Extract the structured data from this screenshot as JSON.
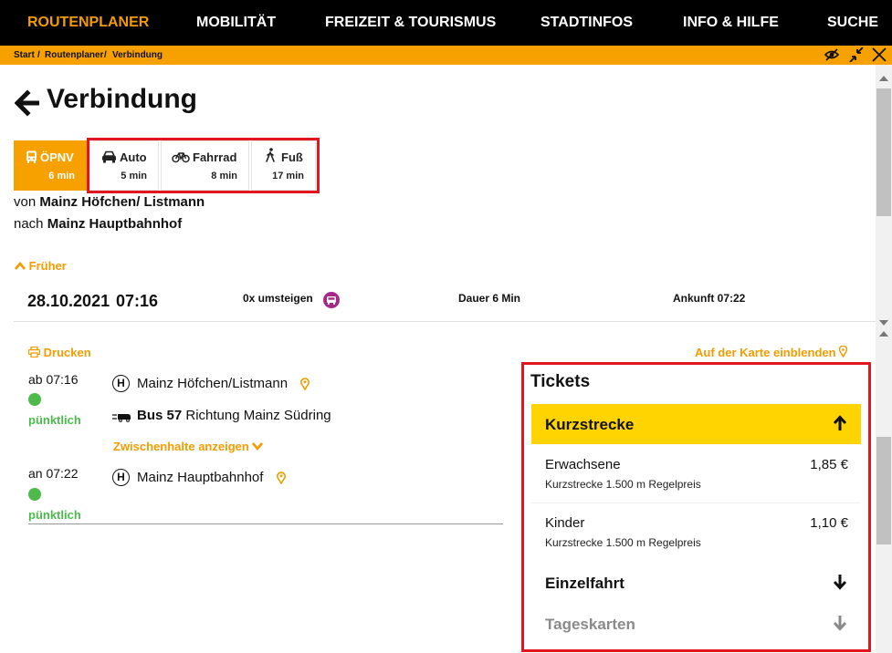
{
  "nav": {
    "items": [
      "ROUTENPLANER",
      "MOBILITÄT",
      "FREIZEIT & TOURISMUS",
      "STADTINFOS",
      "INFO & HILFE",
      "SUCHE"
    ]
  },
  "breadcrumb": {
    "items": [
      "Start",
      "Routenplaner",
      "Verbindung"
    ],
    "separator": "/"
  },
  "page": {
    "title": "Verbindung"
  },
  "modes": [
    {
      "label": "ÖPNV",
      "time": "6 min",
      "icon": "bus-icon",
      "selected": true
    },
    {
      "label": "Auto",
      "time": "5 min",
      "icon": "car-icon",
      "selected": false
    },
    {
      "label": "Fahrrad",
      "time": "8 min",
      "icon": "bicycle-icon",
      "selected": false
    },
    {
      "label": "Fuß",
      "time": "17 min",
      "icon": "walk-icon",
      "selected": false
    }
  ],
  "route": {
    "from_prefix": "von",
    "from": "Mainz Höfchen/ Listmann",
    "to_prefix": "nach",
    "to": "Mainz Hauptbahnhof"
  },
  "earlier_label": "Früher",
  "connection": {
    "date": "28.10.2021",
    "time": "07:16",
    "transfers": "0x umsteigen",
    "duration": "Dauer 6 Min",
    "arrival": "Ankunft 07:22"
  },
  "print_label": "Drucken",
  "map_label": "Auf der Karte einblenden",
  "itinerary": {
    "departure": {
      "time": "ab 07:16",
      "status": "pünktlich",
      "stop": "Mainz Höfchen/Listmann",
      "stop_symbol": "H"
    },
    "line": {
      "name": "Bus 57",
      "direction": "Richtung Mainz Südring"
    },
    "stops_toggle": "Zwischenhalte anzeigen",
    "arrival": {
      "time": "an 07:22",
      "status": "pünktlich",
      "stop": "Mainz Hauptbahnhof",
      "stop_symbol": "H"
    }
  },
  "tickets": {
    "title": "Tickets",
    "groups": [
      {
        "label": "Kurzstrecke",
        "expanded": true
      },
      {
        "label": "Einzelfahrt",
        "expanded": false
      },
      {
        "label": "Tageskarten",
        "expanded": false
      }
    ],
    "rows": [
      {
        "name": "Erwachsene",
        "price": "1,85 €",
        "sub": "Kurzstrecke 1.500 m Regelpreis"
      },
      {
        "name": "Kinder",
        "price": "1,10 €",
        "sub": "Kurzstrecke 1.500 m Regelpreis"
      }
    ]
  },
  "colors": {
    "brand_orange": "#f7a100",
    "highlight_yellow": "#ffd400",
    "ontime_green": "#4cbb4c",
    "annotation_red": "#e3151f",
    "nav_black": "#000000"
  }
}
